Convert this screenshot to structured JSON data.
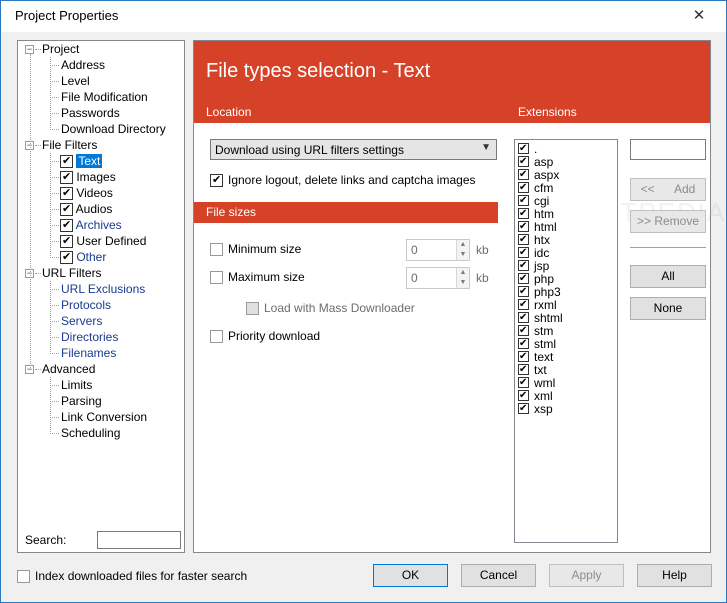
{
  "window": {
    "title": "Project Properties",
    "close_glyph": "✕"
  },
  "tree": {
    "groups": [
      {
        "label": "Project",
        "children": [
          "Address",
          "Level",
          "File Modification",
          "Passwords",
          "Download Directory"
        ]
      },
      {
        "label": "File Filters",
        "children": [
          "Text",
          "Images",
          "Videos",
          "Audios",
          "Archives",
          "User Defined",
          "Other"
        ]
      },
      {
        "label": "URL Filters",
        "children": [
          "URL Exclusions",
          "Protocols",
          "Servers",
          "Directories",
          "Filenames"
        ]
      },
      {
        "label": "Advanced",
        "children": [
          "Limits",
          "Parsing",
          "Link Conversion",
          "Scheduling"
        ]
      }
    ],
    "selected": "Text",
    "expander_glyph": "−",
    "search_label": "Search:",
    "search_value": ""
  },
  "panel": {
    "title": "File types selection - Text",
    "location_label": "Location",
    "extensions_label": "Extensions",
    "location_select": "Download using URL filters settings",
    "ignore_logout_label": "Ignore logout, delete links and captcha images",
    "file_sizes_label": "File sizes",
    "minimum_size_label": "Minimum size",
    "minimum_size_value": "0",
    "maximum_size_label": "Maximum size",
    "maximum_size_value": "0",
    "unit": "kb",
    "mass_downloader_label": "Load with Mass Downloader",
    "priority_label": "Priority download",
    "watermark": "SOFTPEDIA",
    "extensions": [
      ".",
      "asp",
      "aspx",
      "cfm",
      "cgi",
      "htm",
      "html",
      "htx",
      "idc",
      "jsp",
      "php",
      "php3",
      "rxml",
      "shtml",
      "stm",
      "stml",
      "text",
      "txt",
      "wml",
      "xml",
      "xsp"
    ],
    "extension_input": "",
    "add_button": "<<      Add",
    "remove_button": ">> Remove",
    "all_button": "All",
    "none_button": "None"
  },
  "footer": {
    "index_label": "Index downloaded files for faster search",
    "ok": "OK",
    "cancel": "Cancel",
    "apply": "Apply",
    "help": "Help"
  },
  "colors": {
    "accent": "#d64227",
    "selection": "#0078d7",
    "link": "#1a3a8f"
  }
}
